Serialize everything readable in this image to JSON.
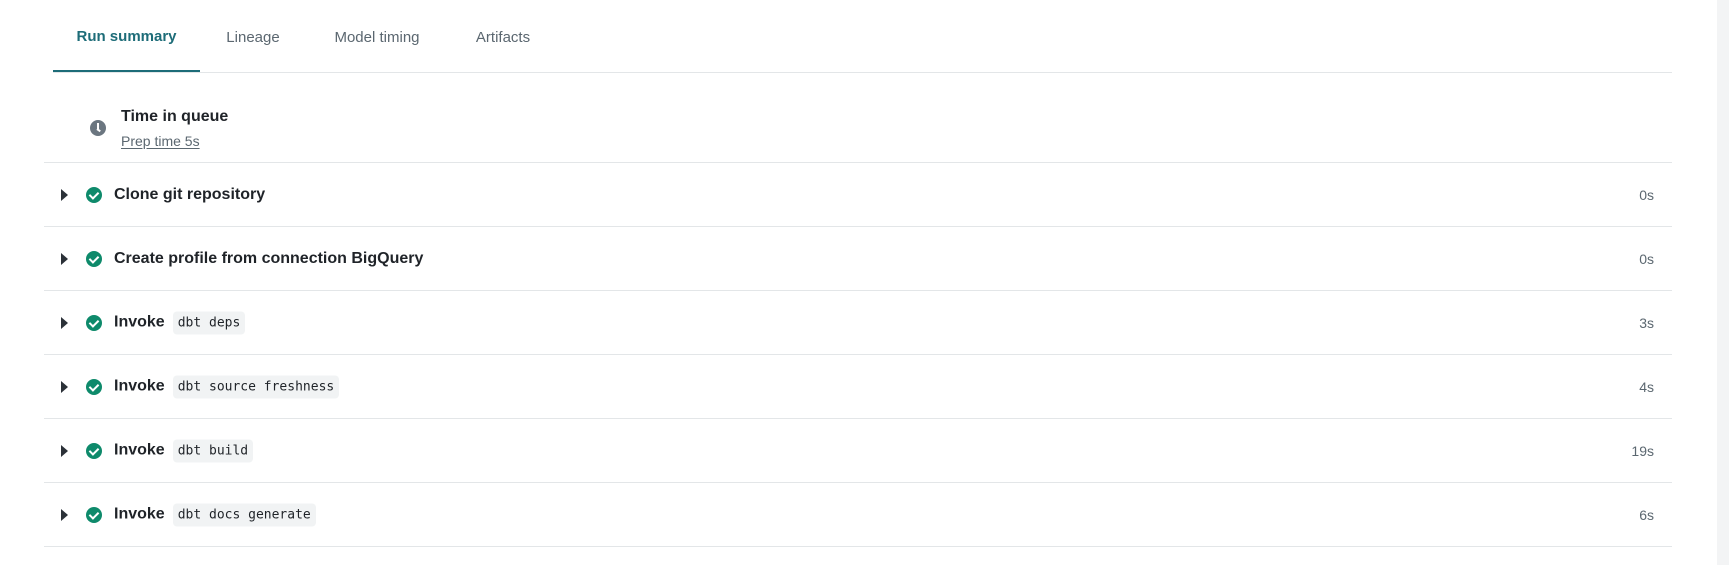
{
  "tabs": [
    {
      "label": "Run summary",
      "active": true
    },
    {
      "label": "Lineage",
      "active": false
    },
    {
      "label": "Model timing",
      "active": false
    },
    {
      "label": "Artifacts",
      "active": false
    }
  ],
  "queue": {
    "icon": "clock-icon",
    "title": "Time in queue",
    "subtitle": "Prep time 5s"
  },
  "steps": [
    {
      "prefix": "Clone git repository",
      "code": "",
      "duration": "0s",
      "status": "success"
    },
    {
      "prefix": "Create profile from connection BigQuery",
      "code": "",
      "duration": "0s",
      "status": "success"
    },
    {
      "prefix": "Invoke",
      "code": "dbt deps",
      "duration": "3s",
      "status": "success"
    },
    {
      "prefix": "Invoke",
      "code": "dbt source freshness",
      "duration": "4s",
      "status": "success"
    },
    {
      "prefix": "Invoke",
      "code": "dbt build",
      "duration": "19s",
      "status": "success"
    },
    {
      "prefix": "Invoke",
      "code": "dbt docs generate",
      "duration": "6s",
      "status": "success"
    }
  ],
  "colors": {
    "accent": "#1d6c78",
    "success": "#0e8a6b",
    "muted": "#5b6770",
    "border": "#e3e6e8"
  }
}
